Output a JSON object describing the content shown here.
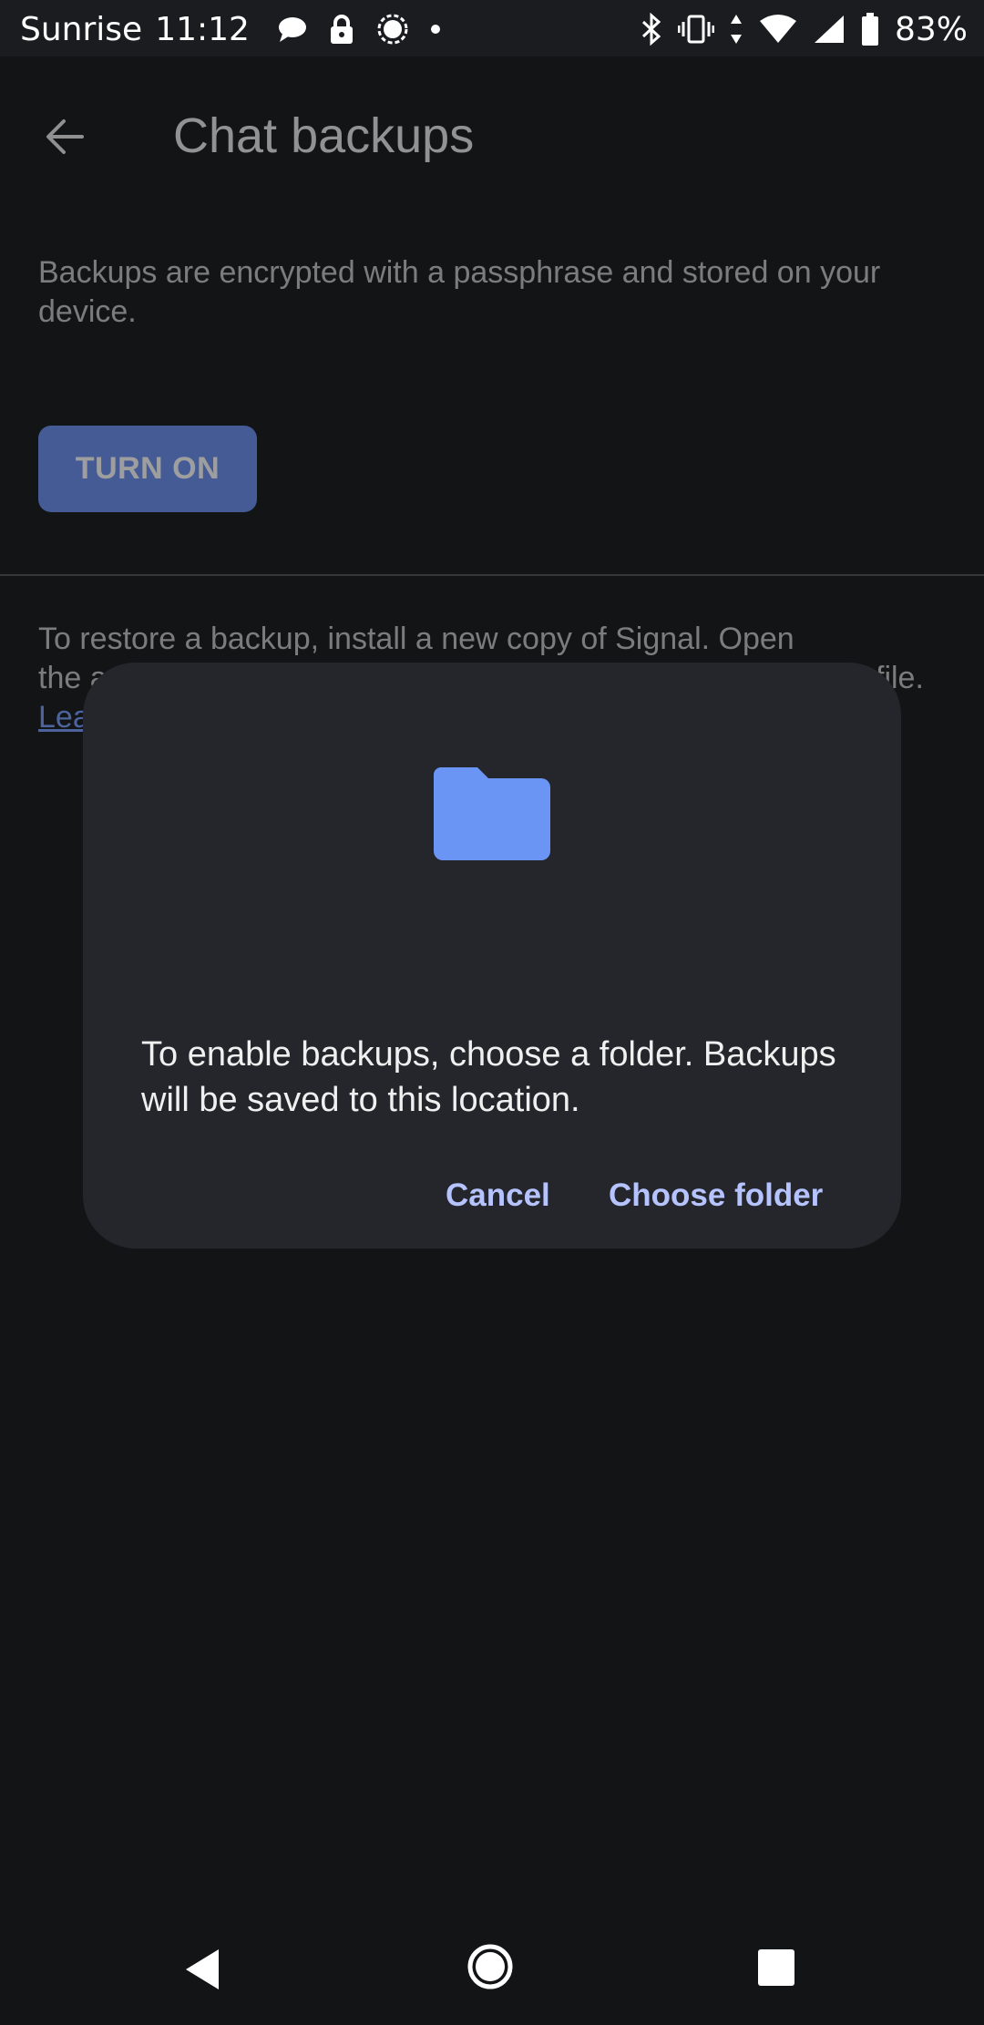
{
  "status_bar": {
    "carrier": "Sunrise",
    "time": "11:12",
    "battery": "83%",
    "left_icons": [
      "chat-bubble-icon",
      "lock-icon",
      "signal-app-icon",
      "dot-icon"
    ],
    "right_icons": [
      "bluetooth-icon",
      "vibrate-icon",
      "data-arrows-icon",
      "wifi-icon",
      "cell-signal-icon",
      "battery-icon"
    ]
  },
  "toolbar": {
    "title": "Chat backups"
  },
  "content": {
    "description": "Backups are encrypted with a passphrase and stored on your device.",
    "turn_on_label": "TURN ON",
    "restore_line1": "To restore a backup, install a new copy of Signal. Open",
    "restore_line2_start": "the a",
    "restore_line2_end": "file.",
    "learn_more_partial": "Lea"
  },
  "dialog": {
    "icon": "folder-icon",
    "message": "To enable backups, choose a folder. Backups will be saved to this location.",
    "cancel_label": "Cancel",
    "choose_label": "Choose folder"
  },
  "colors": {
    "accent": "#6e93f2",
    "dialog_button_text": "#b5c3ff",
    "background": "#131416",
    "dialog_background": "#25262c"
  }
}
